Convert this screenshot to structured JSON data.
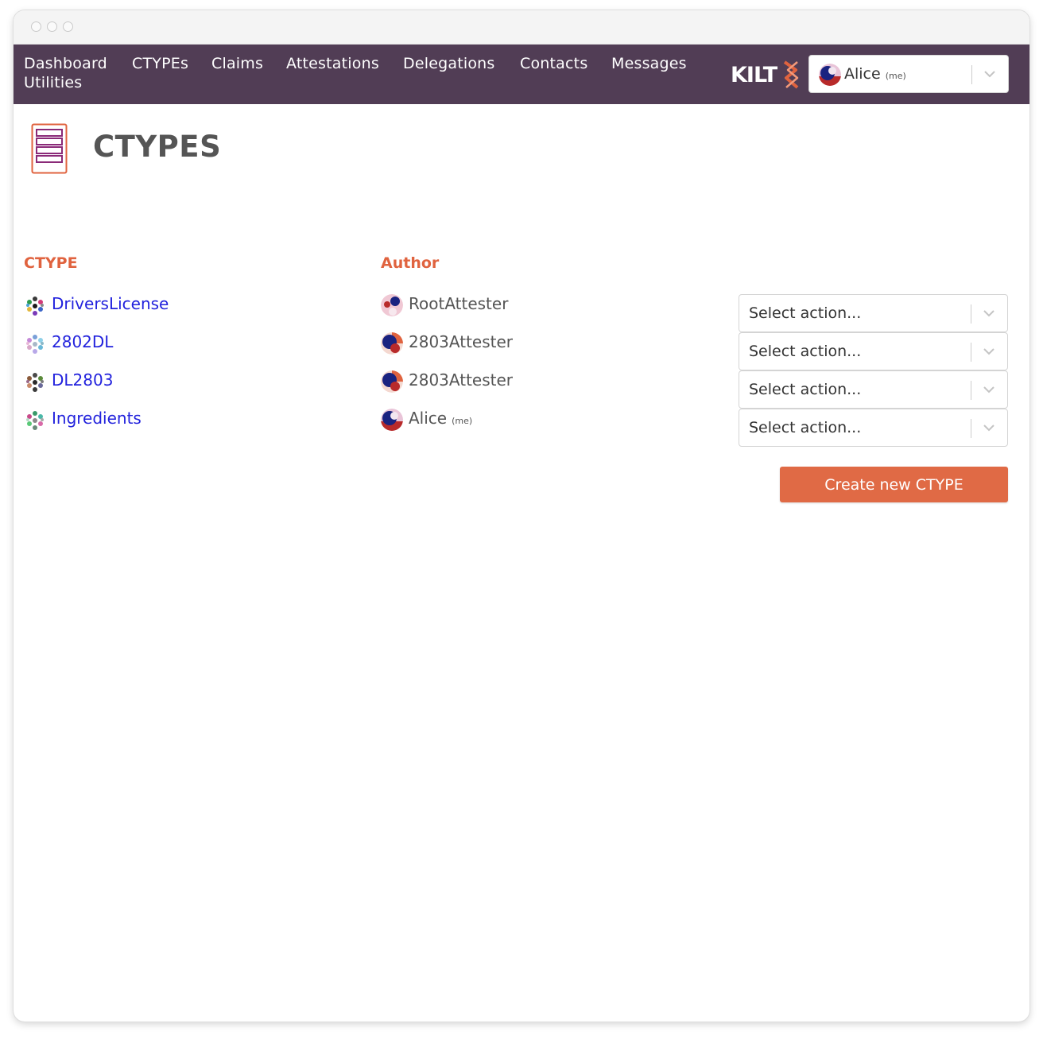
{
  "nav": {
    "items": [
      "Dashboard",
      "CTYPEs",
      "Claims",
      "Attestations",
      "Delegations",
      "Contacts",
      "Messages",
      "Utilities"
    ],
    "logo_text": "KILT"
  },
  "identity_select": {
    "name": "Alice",
    "suffix": "(me)"
  },
  "page": {
    "title": "CTYPES",
    "icon": "ctype-list-icon"
  },
  "table": {
    "headers": {
      "ctype": "CTYPE",
      "author": "Author"
    },
    "rows": [
      {
        "ctype": "DriversLicense",
        "author": "RootAttester",
        "author_suffix": "",
        "action": "Select action..."
      },
      {
        "ctype": "2802DL",
        "author": "2803Attester",
        "author_suffix": "",
        "action": "Select action..."
      },
      {
        "ctype": "DL2803",
        "author": "2803Attester",
        "author_suffix": "",
        "action": "Select action..."
      },
      {
        "ctype": "Ingredients",
        "author": "Alice",
        "author_suffix": "(me)",
        "action": "Select action..."
      }
    ]
  },
  "create_button": {
    "label": "Create new CTYPE"
  },
  "colors": {
    "nav_bg": "#513d55",
    "accent": "#e0633f",
    "link": "#2222dd"
  }
}
